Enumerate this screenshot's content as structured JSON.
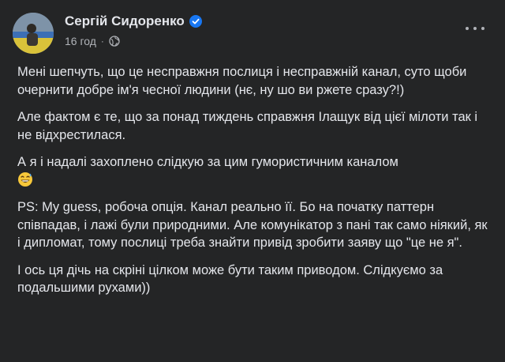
{
  "post": {
    "author": "Сергій Сидоренко",
    "timestamp": "16 год",
    "separator": "·",
    "paragraphs": [
      "Мені шепчуть, що це несправжня послиця і несправжній канал, суто щоби очернити добре ім'я чесної людини (нє, ну шо ви ржете сразу?!)",
      "Але фактом є те, що за понад тиждень справжня Ілащук від цієї мілоти так і не відхрестилася.",
      "А я і надалі захоплено слідкую за цим гумористичним каналом",
      "PS: My guess, робоча опція. Канал реально її. Бо на початку паттерн співпадав, і лажі були природними. Але комунікатор з пані так само ніякий, як і дипломат, тому послиці треба знайти привід зробити заяву що \"це не я\".",
      "І ось ця дічь на скріні цілком може бути таким приводом. Слідкуємо за подальшими рухами))"
    ]
  },
  "icons": {
    "verified": "verified-badge-icon",
    "audience": "globe-icon",
    "more": "more-options-icon",
    "emoji": "grinning-sweat-emoji"
  },
  "colors": {
    "background": "#242526",
    "text": "#e4e6eb",
    "secondary": "#b0b3b8",
    "verified": "#1877f2"
  }
}
